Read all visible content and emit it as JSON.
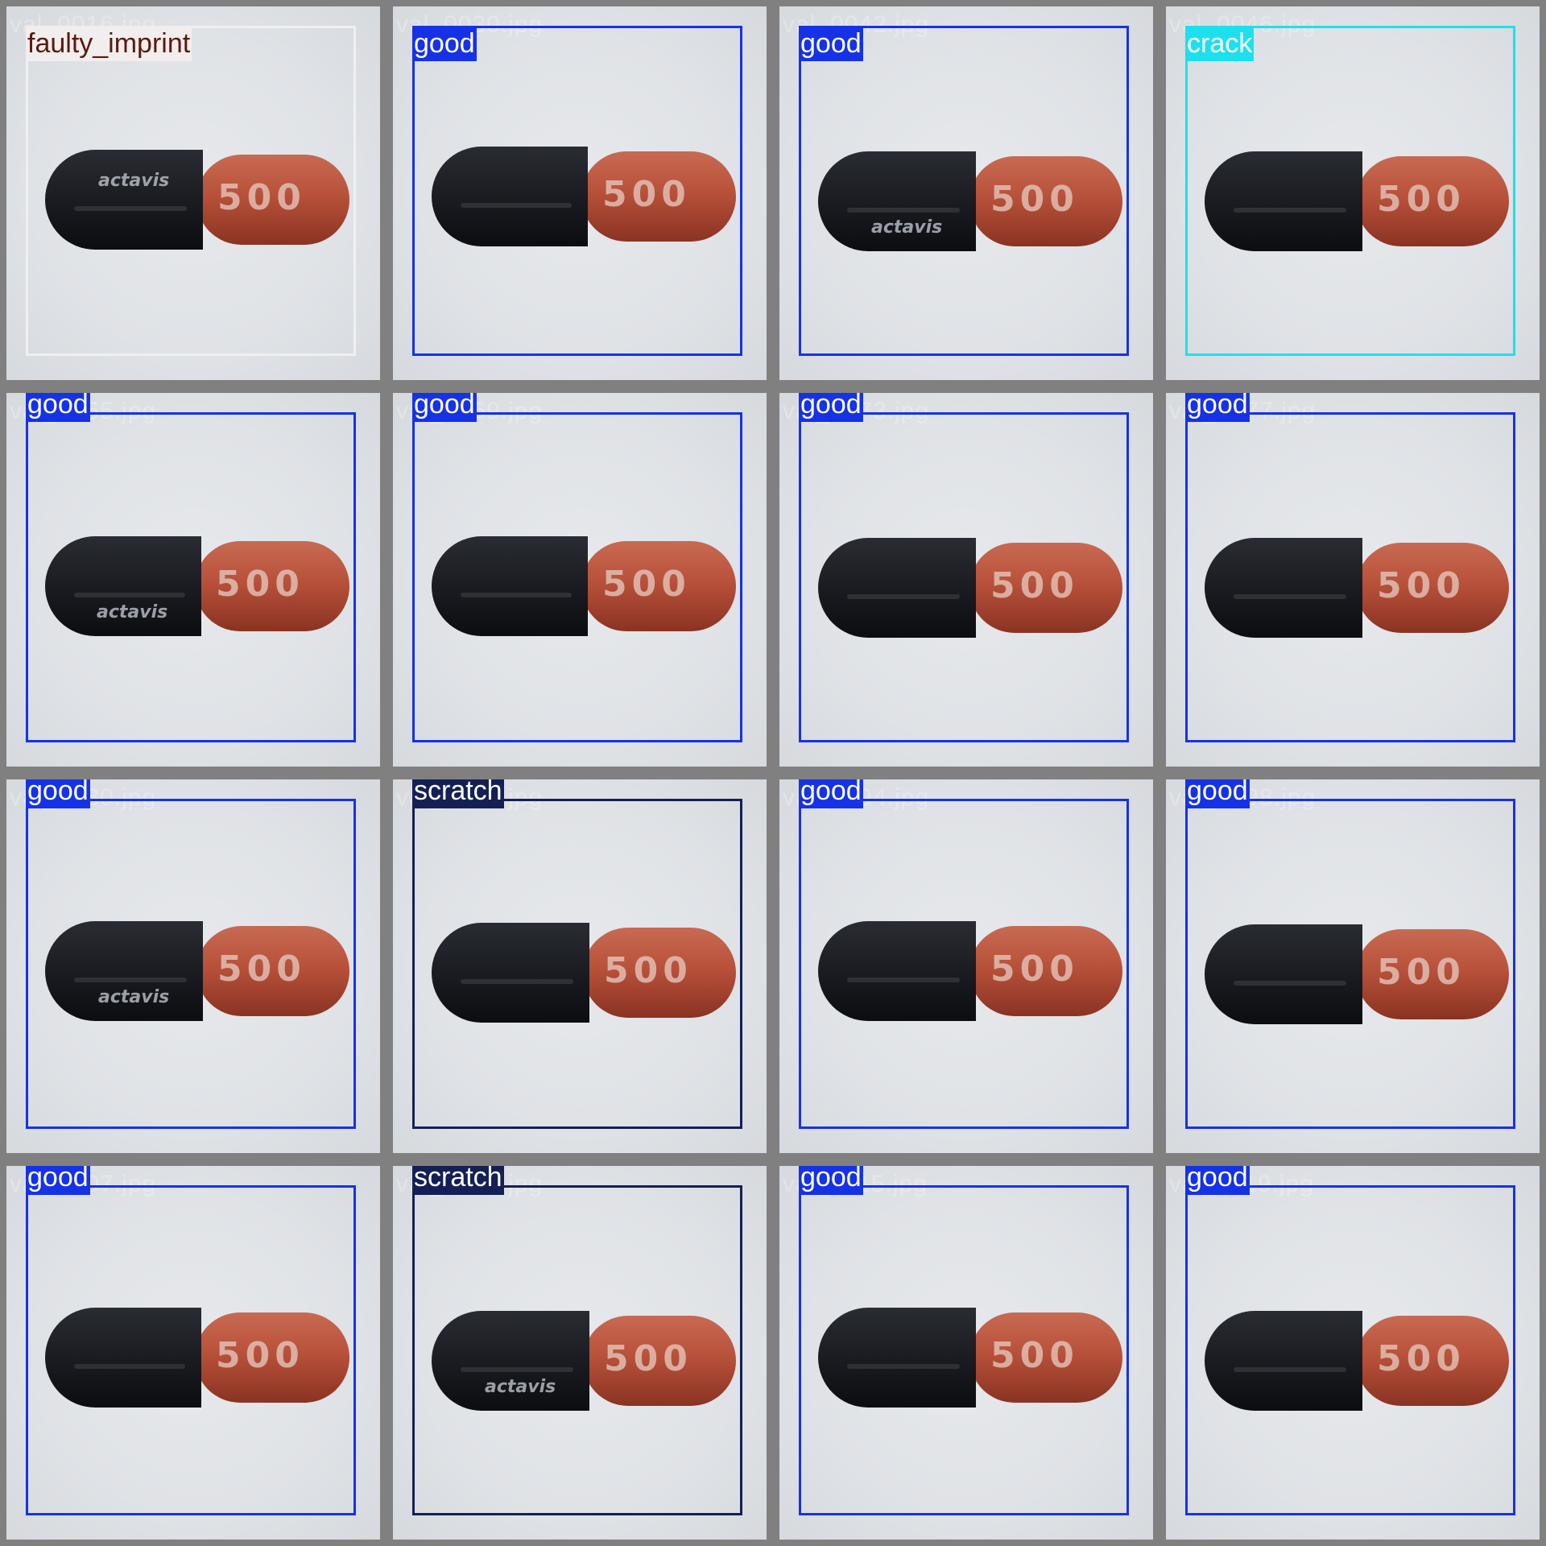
{
  "colors": {
    "good": "#1632e6",
    "faulty_imprint": "#f0f0f0",
    "crack": "#1de0ee",
    "scratch": "#142055",
    "cap_dark": "#1a1c22",
    "body_orange": "#b8513a"
  },
  "tiles": [
    {
      "label": "faulty_imprint",
      "filename": "val_0016.jpg",
      "imprint": "500",
      "logo": "actavis",
      "box_color": "#f0f0f0",
      "tag_bg": "#f2eeee",
      "tag_fg": "#5a1a10"
    },
    {
      "label": "good",
      "filename": "val_0030.jpg",
      "imprint": "500",
      "logo": "",
      "box_color": "#1632e6",
      "tag_bg": "#1632e6",
      "tag_fg": "#ffffff"
    },
    {
      "label": "good",
      "filename": "val_0042.jpg",
      "imprint": "500",
      "logo": "actavis",
      "box_color": "#1632e6",
      "tag_bg": "#1632e6",
      "tag_fg": "#ffffff"
    },
    {
      "label": "crack",
      "filename": "val_0046.jpg",
      "imprint": "500",
      "logo": "",
      "box_color": "#1de0ee",
      "tag_bg": "#1de0ee",
      "tag_fg": "#ffffff"
    },
    {
      "label": "good",
      "filename": "val_0055.jpg",
      "imprint": "500",
      "logo": "actavis",
      "box_color": "#1632e6",
      "tag_bg": "#1632e6",
      "tag_fg": "#ffffff"
    },
    {
      "label": "good",
      "filename": "val_0069.jpg",
      "imprint": "500",
      "logo": "",
      "box_color": "#1632e6",
      "tag_bg": "#1632e6",
      "tag_fg": "#ffffff"
    },
    {
      "label": "good",
      "filename": "val_0073.jpg",
      "imprint": "500",
      "logo": "",
      "box_color": "#1632e6",
      "tag_bg": "#1632e6",
      "tag_fg": "#ffffff"
    },
    {
      "label": "good",
      "filename": "val_0077.jpg",
      "imprint": "500",
      "logo": "",
      "box_color": "#1632e6",
      "tag_bg": "#1632e6",
      "tag_fg": "#ffffff"
    },
    {
      "label": "good",
      "filename": "val_0080.jpg",
      "imprint": "500",
      "logo": "actavis",
      "box_color": "#1632e6",
      "tag_bg": "#1632e6",
      "tag_fg": "#ffffff"
    },
    {
      "label": "scratch",
      "filename": "val_0083.jpg",
      "imprint": "500",
      "logo": "",
      "box_color": "#142055",
      "tag_bg": "#142055",
      "tag_fg": "#ffffff"
    },
    {
      "label": "good",
      "filename": "val_0094.jpg",
      "imprint": "500",
      "logo": "",
      "box_color": "#1632e6",
      "tag_bg": "#1632e6",
      "tag_fg": "#ffffff"
    },
    {
      "label": "good",
      "filename": "val_0098.jpg",
      "imprint": "500",
      "logo": "",
      "box_color": "#1632e6",
      "tag_bg": "#1632e6",
      "tag_fg": "#ffffff"
    },
    {
      "label": "good",
      "filename": "val_0107.jpg",
      "imprint": "500",
      "logo": "",
      "box_color": "#1632e6",
      "tag_bg": "#1632e6",
      "tag_fg": "#ffffff"
    },
    {
      "label": "scratch",
      "filename": "val_0109.jpg",
      "imprint": "500",
      "logo": "actavis",
      "box_color": "#142055",
      "tag_bg": "#142055",
      "tag_fg": "#ffffff"
    },
    {
      "label": "good",
      "filename": "val_0115.jpg",
      "imprint": "500",
      "logo": "",
      "box_color": "#1632e6",
      "tag_bg": "#1632e6",
      "tag_fg": "#ffffff"
    },
    {
      "label": "good",
      "filename": "val_0119.jpg",
      "imprint": "500",
      "logo": "",
      "box_color": "#1632e6",
      "tag_bg": "#1632e6",
      "tag_fg": "#ffffff"
    }
  ]
}
